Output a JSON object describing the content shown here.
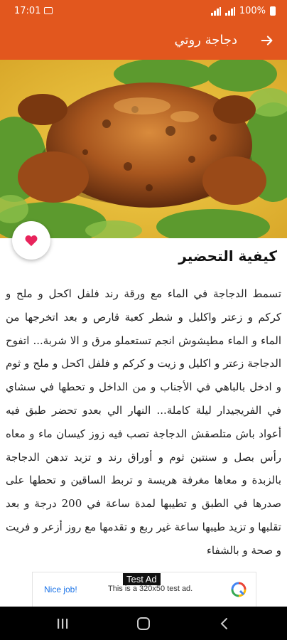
{
  "status_bar": {
    "time": "17:01",
    "battery": "100%"
  },
  "app_bar": {
    "title": "دجاجة روتي"
  },
  "section": {
    "title": "كيفية التحضير"
  },
  "recipe": {
    "text": "تسمط الدجاجة في الماء مع ورقة رند فلفل اكحل و ملح و كركم و زعتر واكليل و شطر كعبة قارص و بعد اتخرجها من الماء و الماء مطيشوش انجم تستعملو مرق و الا شربة... اتفوح الدجاجة زعتر و اكليل و زيت و كركم و فلفل اكحل و ملح و ثوم و ادخل بالباهي في الأجناب و من الداخل و تحطها في سشاي في الفريجيدار ليلة كاملة... النهار الي بعدو تحضر طبق فيه أعواد باش متلصقش الدجاجة تصب فيه زوز كيسان ماء و معاه رأس بصل و سنتين ثوم و أوراق رند و تزيد تدهن الدجاجة بالزبدة و معاها مغرفة هريسة و تربط الساقين و تحطها على صدرها في الطبق و تطيبها لمدة ساعة في 200 درجة و بعد تقلبها و تزيد طيبها ساعة غير ربع و تقدمها مع روز أزعر و فريت و صحة و بالشفاء"
  },
  "ad": {
    "label": "Test Ad",
    "nice": "Nice job!",
    "text": "This is a 320x50 test ad."
  },
  "colors": {
    "primary": "#e2571e",
    "favorite": "#e8245c"
  },
  "icons": {
    "back": "arrow-right-icon",
    "favorite": "heart-icon"
  }
}
